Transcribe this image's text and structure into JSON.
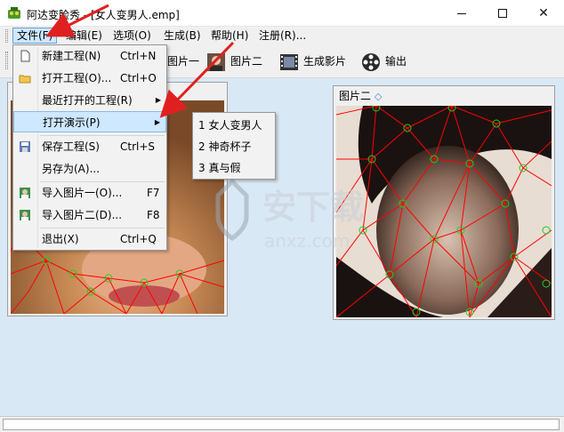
{
  "window": {
    "title": "阿达变脸秀 - [女人变男人.emp]",
    "minimize_glyph": "—",
    "close_glyph": "✕"
  },
  "menubar": {
    "items": [
      "文件(F)",
      "编辑(E)",
      "选项(O)",
      "生成(B)",
      "帮助(H)",
      "注册(R)..."
    ]
  },
  "toolbar": {
    "buttons": [
      "图片一",
      "图片二",
      "生成影片",
      "输出"
    ]
  },
  "panels": {
    "right_title": "图片二"
  },
  "file_menu": {
    "items": [
      {
        "label": "新建工程(N)",
        "shortcut": "Ctrl+N",
        "icon": "new-file-icon"
      },
      {
        "label": "打开工程(O)...",
        "shortcut": "Ctrl+O",
        "icon": "open-folder-icon"
      },
      {
        "label": "最近打开的工程(R)",
        "shortcut": "",
        "icon": ""
      },
      {
        "label": "打开演示(P)",
        "shortcut": "",
        "icon": ""
      },
      {
        "label": "保存工程(S)",
        "shortcut": "Ctrl+S",
        "icon": "save-icon"
      },
      {
        "label": "另存为(A)...",
        "shortcut": "",
        "icon": ""
      },
      {
        "label": "导入图片一(O)...",
        "shortcut": "F7",
        "icon": "import-image-icon"
      },
      {
        "label": "导入图片二(D)...",
        "shortcut": "F8",
        "icon": "import-image-icon"
      },
      {
        "label": "退出(X)",
        "shortcut": "Ctrl+Q",
        "icon": ""
      }
    ],
    "submenu_arrow": "▶"
  },
  "demo_submenu": {
    "items": [
      "1 女人变男人",
      "2 神奇杯子",
      "3 真与假"
    ]
  },
  "watermark": {
    "cn": "安下载",
    "en": "anxz.com"
  },
  "colors": {
    "menu_highlight": "#cde8ff",
    "workspace_bg": "#d9e8f5",
    "mesh_line": "#ff0000",
    "mesh_node": "#22cc22",
    "annotation_arrow": "#e02020"
  }
}
